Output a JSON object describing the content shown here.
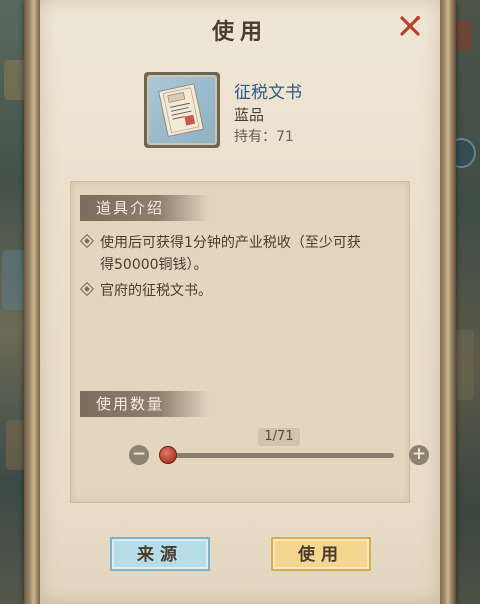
{
  "dialog": {
    "title": "使用"
  },
  "item": {
    "name": "征税文书",
    "quality": "蓝品",
    "count_label": "持有：71",
    "icon": "tax-document-icon",
    "name_color": "#2d5a8a"
  },
  "description": {
    "heading": "道具介绍",
    "lines": [
      "使用后可获得1分钟的产业税收（至少可获",
      "得50000铜钱）。",
      "官府的征税文书。"
    ]
  },
  "quantity": {
    "heading": "使用数量",
    "value_label": "1/71",
    "current": 1,
    "max": 71,
    "minus_label": "−",
    "plus_label": "+"
  },
  "buttons": {
    "source_label": "来源",
    "use_label": "使用"
  },
  "colors": {
    "parchment": "#eadfcb",
    "source_button": "#b6dde8",
    "use_button": "#f4d690",
    "close_x": "#b9432f",
    "knob": "#b9432f"
  }
}
